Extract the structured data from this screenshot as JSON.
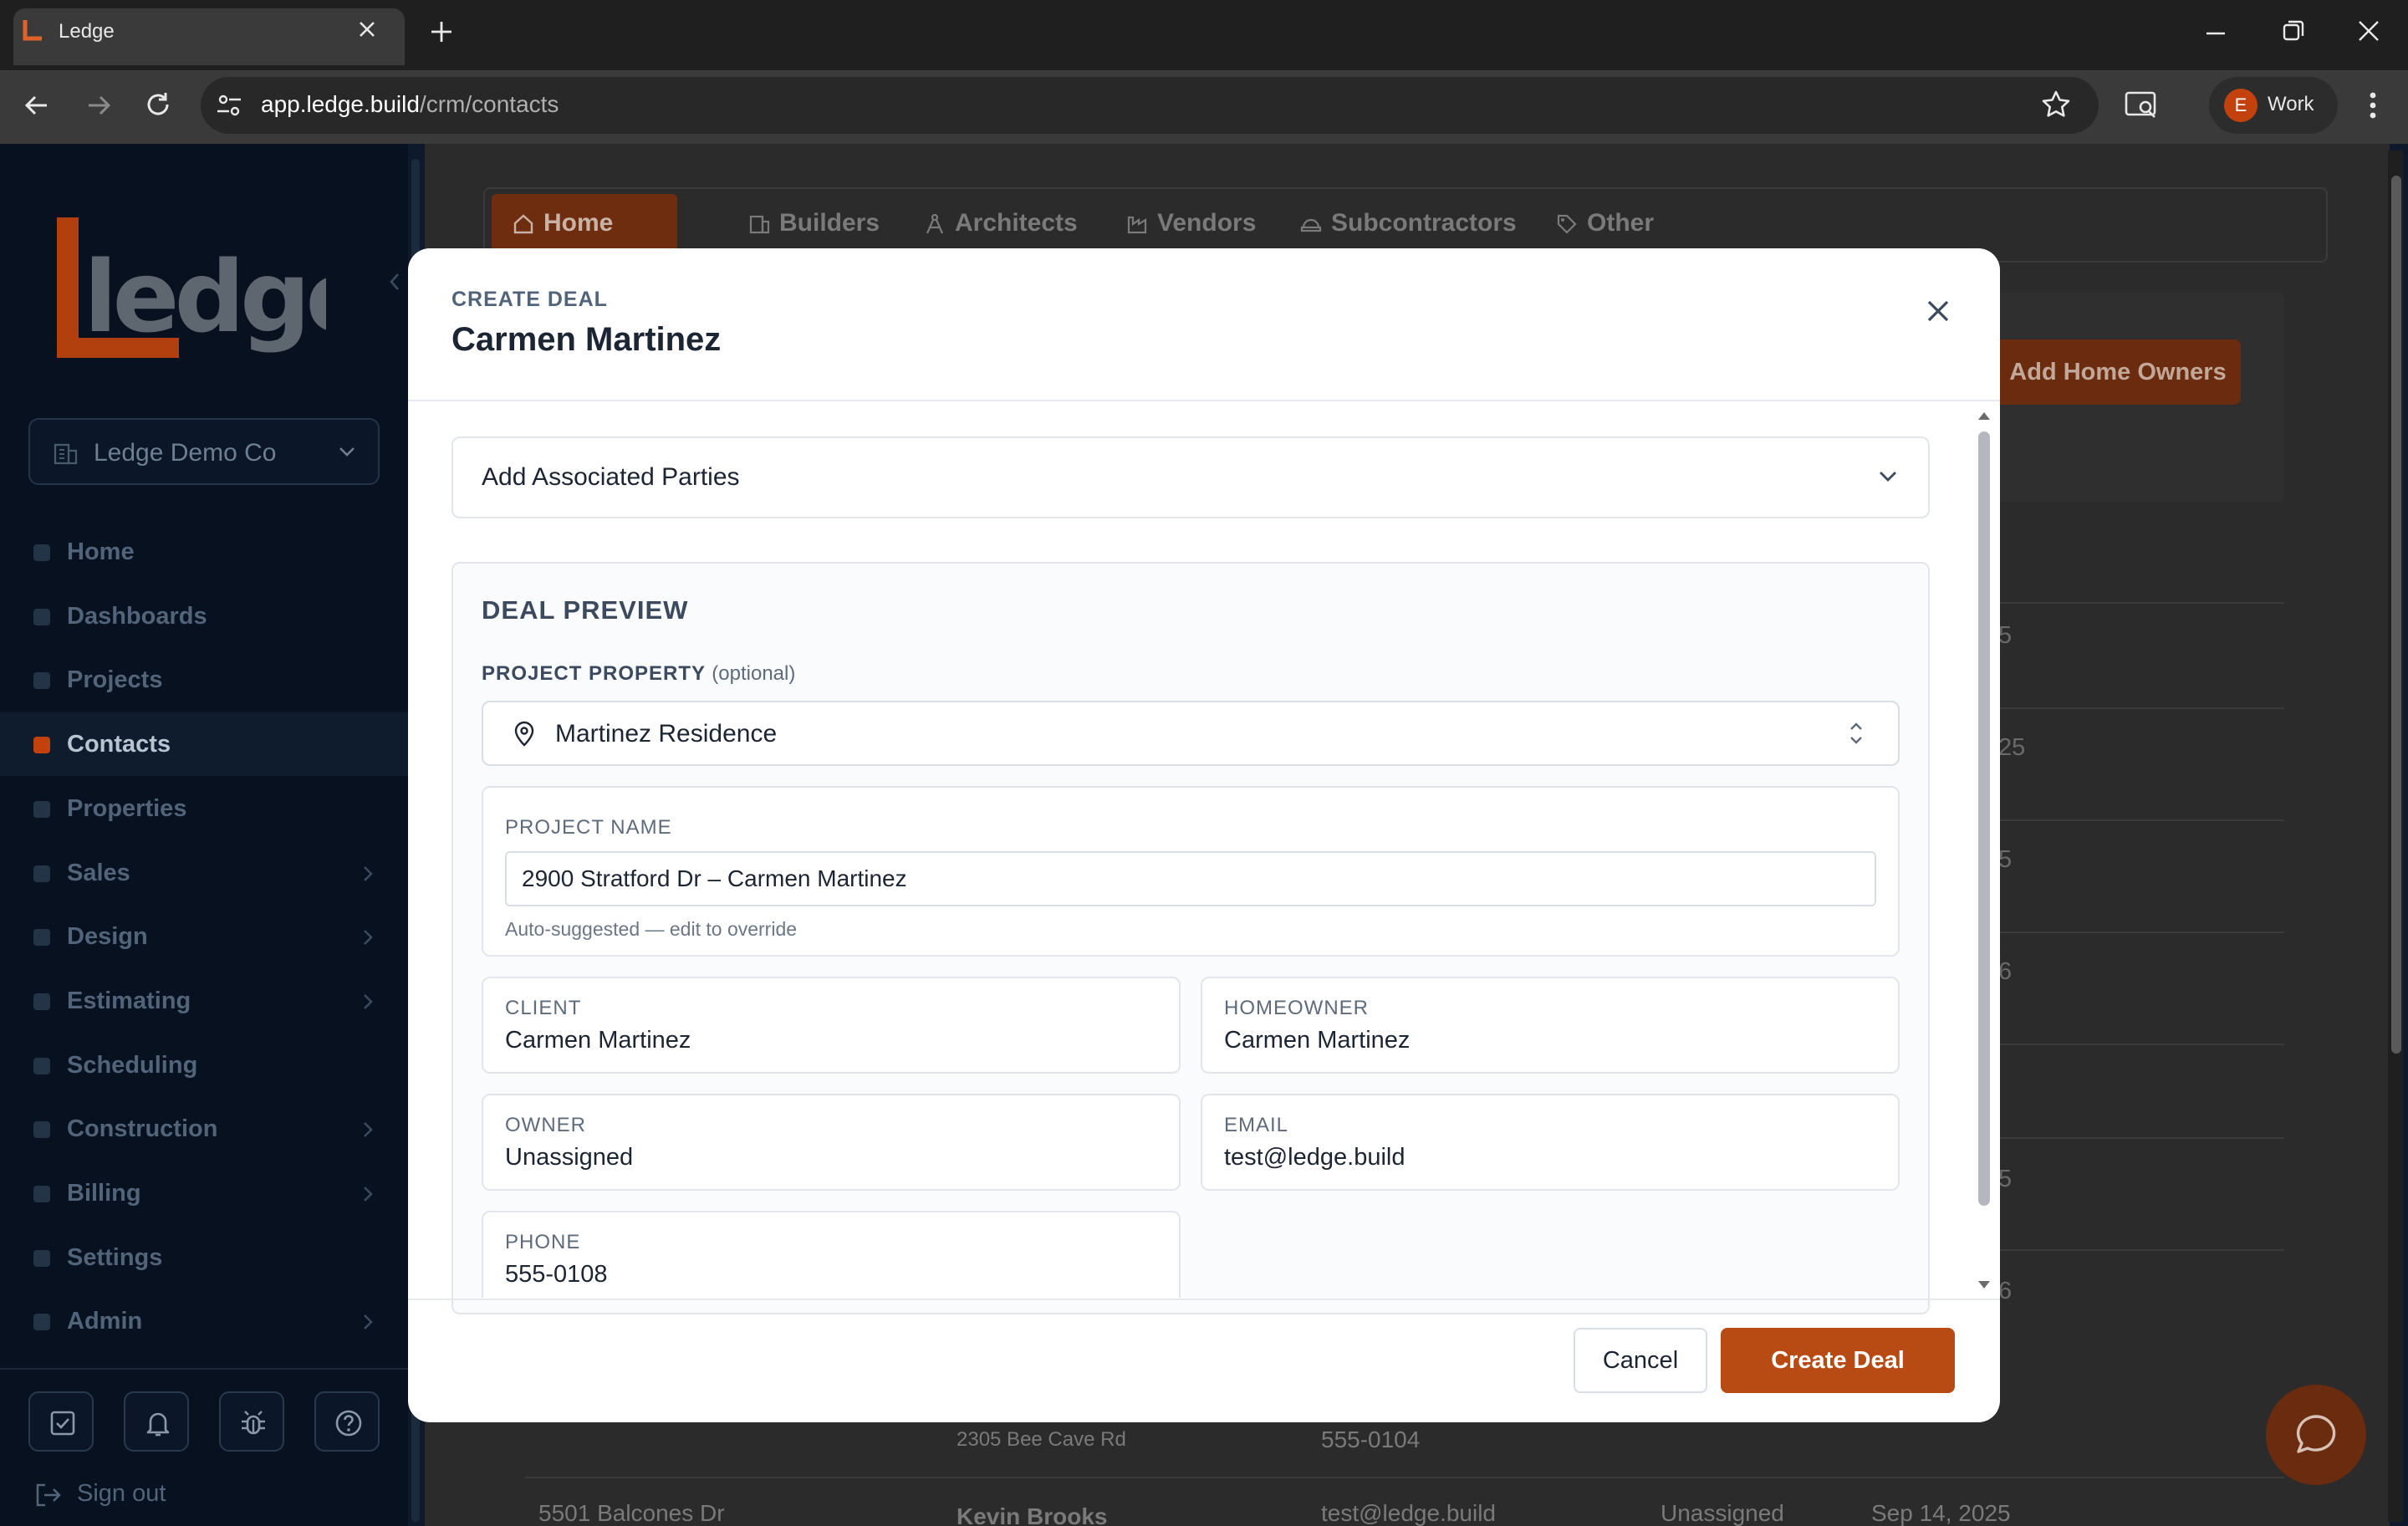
{
  "browser": {
    "tab_title": "Ledge",
    "url_host": "app.ledge.build",
    "url_path": "/crm/contacts",
    "profile_initial": "E",
    "profile_label": "Work"
  },
  "sidebar": {
    "org_name": "Ledge Demo Co",
    "items": [
      {
        "label": "Home",
        "has_chevron": false
      },
      {
        "label": "Dashboards",
        "has_chevron": false
      },
      {
        "label": "Projects",
        "has_chevron": false
      },
      {
        "label": "Contacts",
        "has_chevron": false,
        "active": true
      },
      {
        "label": "Properties",
        "has_chevron": false
      },
      {
        "label": "Sales",
        "has_chevron": true
      },
      {
        "label": "Design",
        "has_chevron": true
      },
      {
        "label": "Estimating",
        "has_chevron": true
      },
      {
        "label": "Scheduling",
        "has_chevron": false
      },
      {
        "label": "Construction",
        "has_chevron": true
      },
      {
        "label": "Billing",
        "has_chevron": true
      },
      {
        "label": "Settings",
        "has_chevron": false
      },
      {
        "label": "Admin",
        "has_chevron": true
      }
    ],
    "footer_icons": [
      "checkbox-icon",
      "bell-icon",
      "bug-icon",
      "help-icon"
    ],
    "sign_out": "Sign out"
  },
  "background": {
    "contact_tabs": [
      "Home Owners",
      "Builders",
      "Architects",
      "Vendors",
      "Subcontractors",
      "Other"
    ],
    "add_button": "Add Home Owners",
    "row_fragments": [
      "5",
      "25",
      "5",
      "6",
      "5",
      "6"
    ],
    "row_address_partial": "2305 Bee Cave Rd",
    "row_phone_partial": "555-0104",
    "last_row": {
      "address": "5501 Balcones Dr",
      "name": "Kevin Brooks",
      "email": "test@ledge.build",
      "owner": "Unassigned",
      "date": "Sep 14, 2025"
    }
  },
  "modal": {
    "eyebrow": "CREATE DEAL",
    "title": "Carmen Martinez",
    "associated_parties": "Add Associated Parties",
    "preview_title": "DEAL PREVIEW",
    "property_label": "PROJECT PROPERTY",
    "property_optional": "(optional)",
    "property_value": "Martinez Residence",
    "project_name_label": "PROJECT NAME",
    "project_name_value": "2900 Stratford Dr – Carmen Martinez",
    "project_name_hint": "Auto-suggested — edit to override",
    "client_label": "CLIENT",
    "client_value": "Carmen Martinez",
    "homeowner_label": "HOMEOWNER",
    "homeowner_value": "Carmen Martinez",
    "owner_label": "OWNER",
    "owner_value": "Unassigned",
    "email_label": "EMAIL",
    "email_value": "test@ledge.build",
    "phone_label": "PHONE",
    "phone_value": "555-0108",
    "cancel": "Cancel",
    "create": "Create Deal"
  },
  "colors": {
    "accent": "#b84a14",
    "sidebar_bg": "#071120",
    "overlay_dim": "#2b2b2b"
  }
}
